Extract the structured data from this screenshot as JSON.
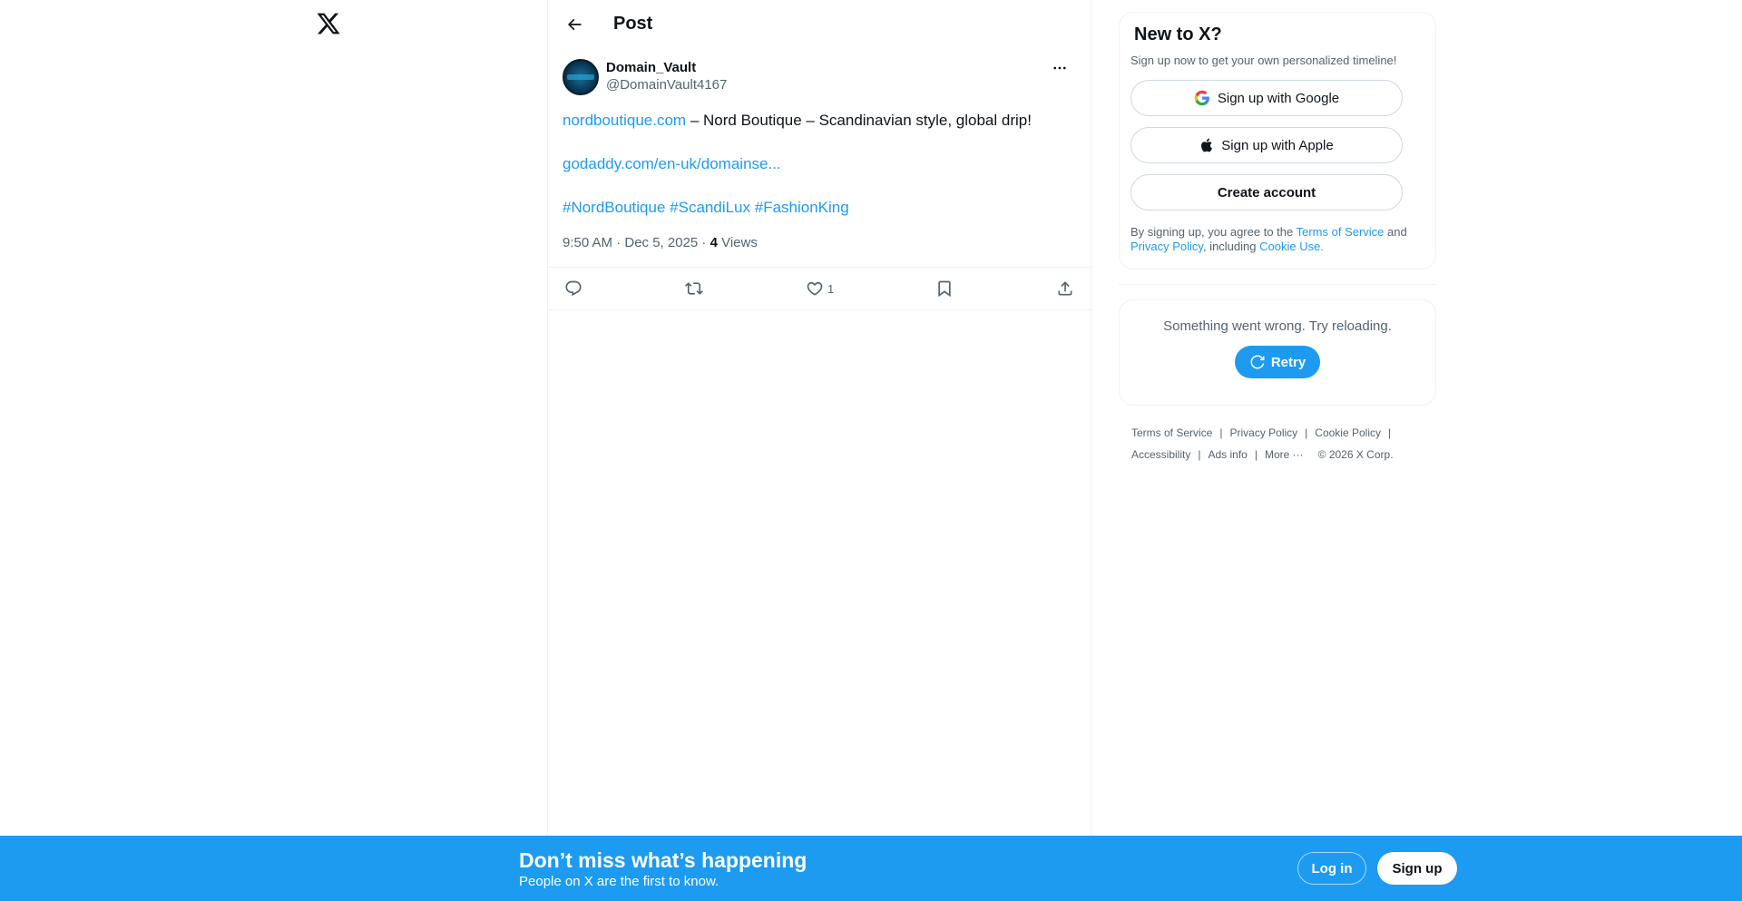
{
  "page": {
    "title": "Post"
  },
  "post": {
    "display_name": "Domain_Vault",
    "handle": "@DomainVault4167",
    "line1_link": "nordboutique.com",
    "line1_text": " – Nord Boutique – Scandinavian style, global drip!",
    "line2_link": "godaddy.com/en-uk/domainse...",
    "hashtags": [
      "#NordBoutique",
      "#ScandiLux",
      "#FashionKing"
    ],
    "time": "9:50 AM · Dec 5, 2025 · ",
    "views_count": "4",
    "views_label": " Views",
    "like_count": "1"
  },
  "signup": {
    "title": "New to X?",
    "subtitle": "Sign up now to get your own personalized timeline!",
    "google_label": "Sign up with Google",
    "apple_label": "Sign up with Apple",
    "create_label": "Create account",
    "terms_prefix": "By signing up, you agree to the ",
    "terms_link": "Terms of Service",
    "terms_and": " and ",
    "privacy_link": "Privacy Policy",
    "terms_mid": ", including ",
    "cookie_link": "Cookie Use."
  },
  "error": {
    "message": "Something went wrong. Try reloading.",
    "retry_label": "Retry"
  },
  "footer": {
    "row1": [
      "Terms of Service",
      "Privacy Policy",
      "Cookie Policy"
    ],
    "row2": [
      "Accessibility",
      "Ads info"
    ],
    "more": "More ···",
    "copyright": "© 2026 X Corp."
  },
  "banner": {
    "title": "Don’t miss what’s happening",
    "subtitle": "People on X are the first to know.",
    "login_label": "Log in",
    "signup_label": "Sign up"
  },
  "colors": {
    "accent": "#1d9bf0",
    "text": "#0f1419",
    "muted": "#536471",
    "border": "#eff3f4"
  },
  "icons": [
    "x-logo-icon",
    "back-arrow-icon",
    "more-icon",
    "reply-icon",
    "repost-icon",
    "like-icon",
    "bookmark-icon",
    "share-icon",
    "google-icon",
    "apple-icon",
    "refresh-icon"
  ]
}
